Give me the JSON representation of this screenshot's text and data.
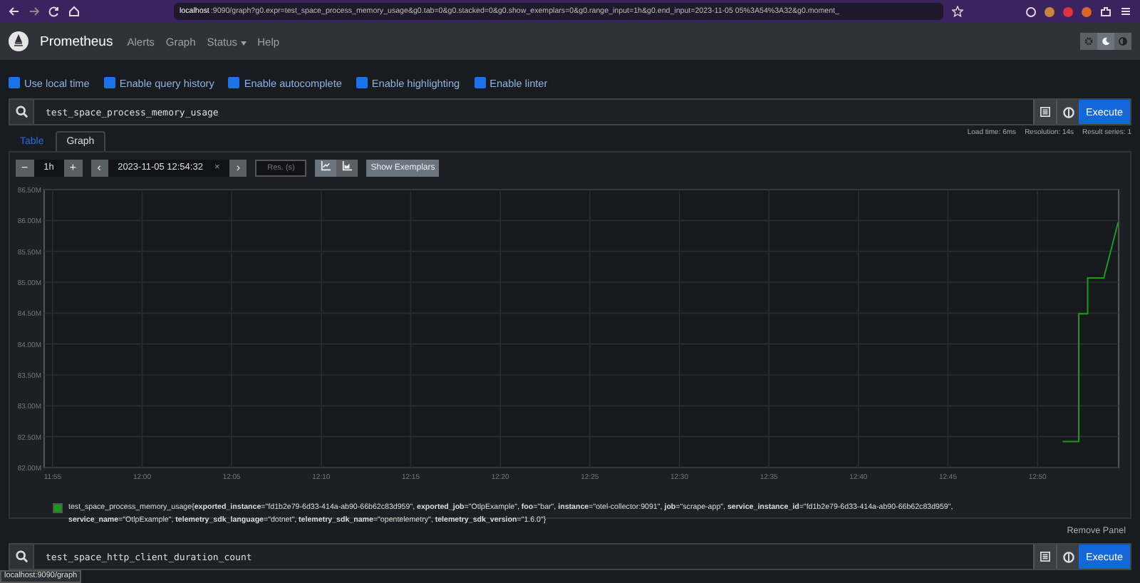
{
  "browser": {
    "url_host": "localhost",
    "url_rest": ":9090/graph?g0.expr=test_space_process_memory_usage&g0.tab=0&g0.stacked=0&g0.show_exemplars=0&g0.range_input=1h&g0.end_input=2023-11-05 05%3A54%3A32&g0.moment_"
  },
  "navbar": {
    "brand": "Prometheus",
    "links": [
      {
        "label": "Alerts",
        "kind": "link"
      },
      {
        "label": "Graph",
        "kind": "link"
      },
      {
        "label": "Status",
        "kind": "dropdown"
      },
      {
        "label": "Help",
        "kind": "link"
      }
    ]
  },
  "options": [
    {
      "label": "Use local time",
      "checked": true
    },
    {
      "label": "Enable query history",
      "checked": true
    },
    {
      "label": "Enable autocomplete",
      "checked": true
    },
    {
      "label": "Enable highlighting",
      "checked": true
    },
    {
      "label": "Enable linter",
      "checked": true
    }
  ],
  "query": {
    "value": "test_space_process_memory_usage",
    "execute": "Execute"
  },
  "stats": [
    "Load time: 6ms",
    "Resolution: 14s",
    "Result series: 1"
  ],
  "tabs": [
    {
      "label": "Table",
      "selected": false
    },
    {
      "label": "Graph",
      "selected": true
    }
  ],
  "controls": {
    "minus": "−",
    "range": "1h",
    "plus": "+",
    "prev": "‹",
    "end_time": "2023-11-05 12:54:32",
    "clear": "×",
    "next": "›",
    "resolution_placeholder": "Res. (s)",
    "chart_modes": [
      {
        "kind": "line",
        "selected": true
      },
      {
        "kind": "stacked",
        "selected": false
      }
    ],
    "exemplars": "Show Exemplars"
  },
  "chart_data": {
    "type": "line",
    "grid": true,
    "xlim": [
      714.53,
      774.53
    ],
    "ylim": [
      82.0,
      86.5
    ],
    "xticks": [
      {
        "value": 715,
        "label": "11:55"
      },
      {
        "value": 720,
        "label": "12:00"
      },
      {
        "value": 725,
        "label": "12:05"
      },
      {
        "value": 730,
        "label": "12:10"
      },
      {
        "value": 735,
        "label": "12:15"
      },
      {
        "value": 740,
        "label": "12:20"
      },
      {
        "value": 745,
        "label": "12:25"
      },
      {
        "value": 750,
        "label": "12:30"
      },
      {
        "value": 755,
        "label": "12:35"
      },
      {
        "value": 760,
        "label": "12:40"
      },
      {
        "value": 765,
        "label": "12:45"
      },
      {
        "value": 770,
        "label": "12:50"
      }
    ],
    "yticks": [
      {
        "value": 82.0,
        "label": "82.00M"
      },
      {
        "value": 82.5,
        "label": "82.50M"
      },
      {
        "value": 83.0,
        "label": "83.00M"
      },
      {
        "value": 83.5,
        "label": "83.50M"
      },
      {
        "value": 84.0,
        "label": "84.00M"
      },
      {
        "value": 84.5,
        "label": "84.50M"
      },
      {
        "value": 85.0,
        "label": "85.00M"
      },
      {
        "value": 85.5,
        "label": "85.50M"
      },
      {
        "value": 86.0,
        "label": "86.00M"
      },
      {
        "value": 86.5,
        "label": "86.50M"
      }
    ],
    "x": [
      771.4,
      772.3,
      772.3,
      772.8,
      772.8,
      773.7,
      773.7,
      774.5
    ],
    "series": [
      {
        "name": "test_space_process_memory_usage",
        "color": "#1a9a1a",
        "values": [
          82.42,
          82.42,
          84.49,
          84.49,
          85.07,
          85.07,
          85.07,
          85.97
        ]
      }
    ]
  },
  "legend": "{**exported_instance**=\"fd1b2e79-6d33-414a-ab90-66b62c83d959\", **exported_job**=\"OtlpExample\", **foo**=\"bar\", **instance**=\"otel-collector:9091\", **job**=\"scrape-app\", **service_instance_id**=\"fd1b2e79-6d33-414a-ab90-66b62c83d959\", **service_name**=\"OtlpExample\", **telemetry_sdk_language**=\"dotnet\", **telemetry_sdk_name**=\"opentelemetry\", **telemetry_sdk_version**=\"1.6.0\"}",
  "remove_panel": "Remove Panel",
  "query2": {
    "value": "test_space_http_client_duration_count",
    "execute": "Execute"
  },
  "status_link": "localhost:9090/graph"
}
